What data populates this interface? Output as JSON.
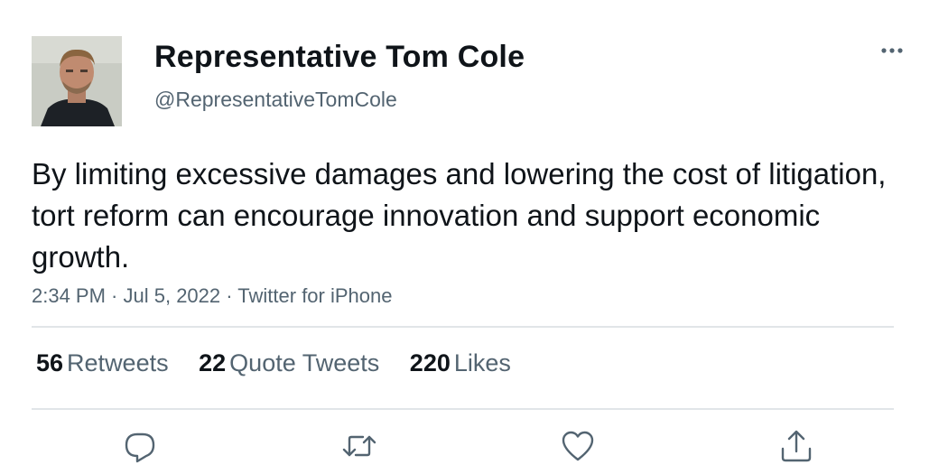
{
  "tweet": {
    "author": {
      "display_name": "Representative Tom Cole",
      "handle": "@RepresentativeTomCole"
    },
    "text": "By limiting excessive damages and lowering the cost of litigation, tort reform can encourage innovation and support economic growth.",
    "time": "2:34 PM",
    "separator": " · ",
    "date": "Jul 5, 2022",
    "source": "Twitter for iPhone",
    "stats": {
      "retweets": {
        "count": "56",
        "label": "Retweets"
      },
      "quote_tweets": {
        "count": "22",
        "label": "Quote Tweets"
      },
      "likes": {
        "count": "220",
        "label": "Likes"
      }
    },
    "icons": {
      "more": "more-horizontal-icon",
      "reply": "reply-icon",
      "retweet": "retweet-icon",
      "like": "heart-icon",
      "share": "share-icon"
    }
  },
  "colors": {
    "text_primary": "#0f1419",
    "text_secondary": "#536471",
    "divider": "#e1e5e8",
    "icon": "#536471"
  }
}
